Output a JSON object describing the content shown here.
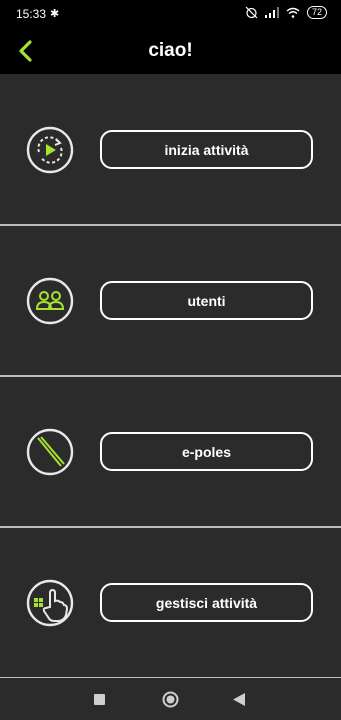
{
  "status": {
    "time": "15:33",
    "battery": "72"
  },
  "header": {
    "title": "ciao!"
  },
  "menu": [
    {
      "label": "inizia attività",
      "icon": "play-refresh-icon"
    },
    {
      "label": "utenti",
      "icon": "users-icon"
    },
    {
      "label": "e-poles",
      "icon": "poles-icon"
    },
    {
      "label": "gestisci attività",
      "icon": "hand-grid-icon"
    }
  ],
  "colors": {
    "accent": "#a6e22e",
    "background": "#2b2b2b",
    "bar": "#000000"
  }
}
